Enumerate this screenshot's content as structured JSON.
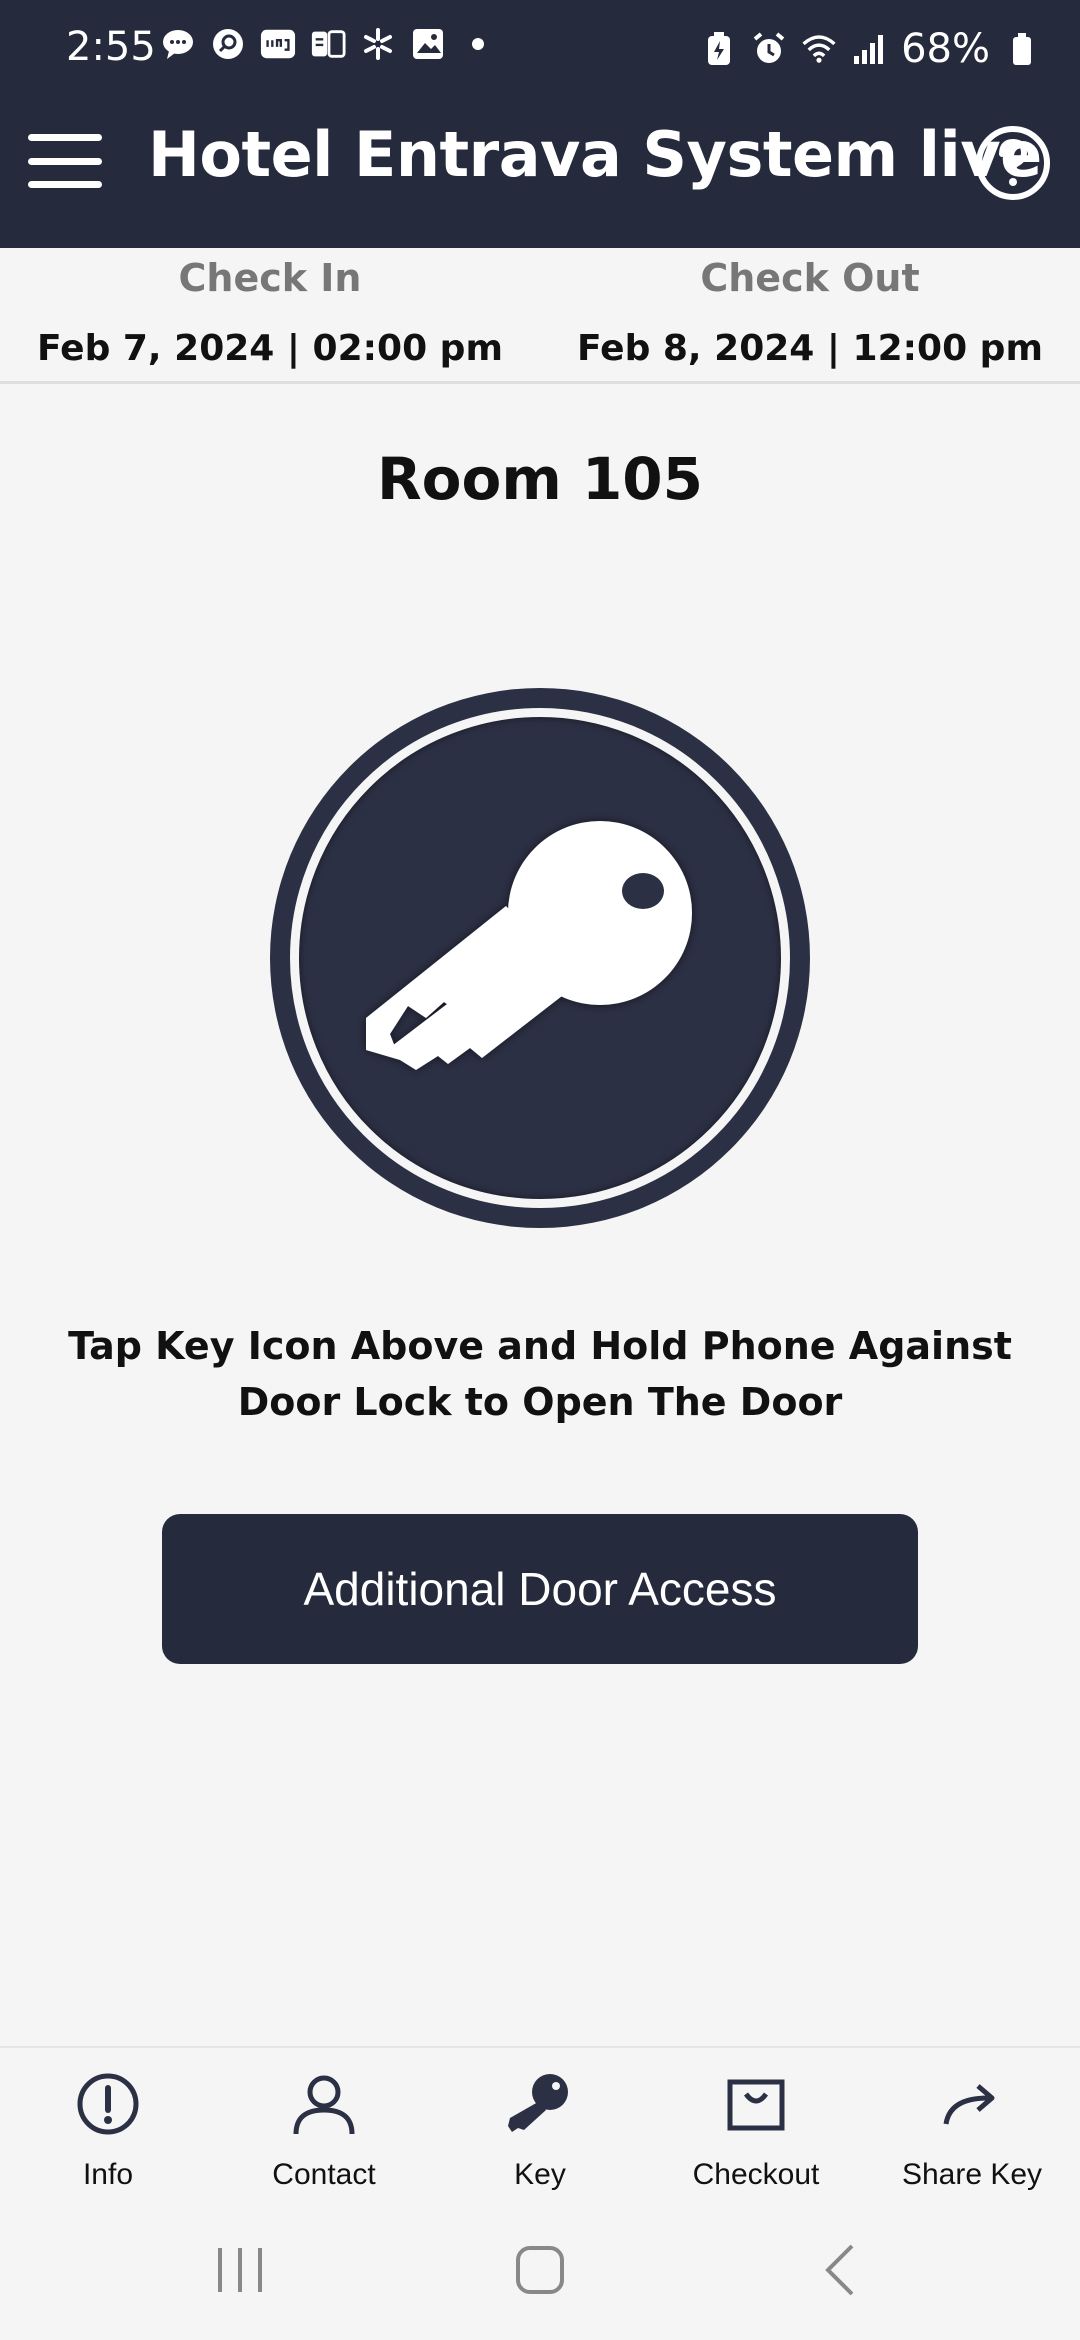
{
  "status": {
    "time": "2:55",
    "battery": "68%"
  },
  "app": {
    "title": "Hotel Entrava System live"
  },
  "stay": {
    "check_in_label": "Check In",
    "check_in_value": "Feb 7, 2024 | 02:00 pm",
    "check_out_label": "Check Out",
    "check_out_value": "Feb 8, 2024 | 12:00 pm"
  },
  "room": {
    "title": "Room 105"
  },
  "instructions": "Tap Key Icon Above and Hold Phone Against Door Lock to Open The Door",
  "access_button": "Additional Door Access",
  "bottom_nav": [
    {
      "label": "Info",
      "icon": "info-icon"
    },
    {
      "label": "Contact",
      "icon": "person-icon"
    },
    {
      "label": "Key",
      "icon": "key-icon"
    },
    {
      "label": "Checkout",
      "icon": "bag-icon"
    },
    {
      "label": "Share Key",
      "icon": "share-icon"
    }
  ],
  "colors": {
    "primary": "#262a3d",
    "background": "#f5f5f5"
  }
}
